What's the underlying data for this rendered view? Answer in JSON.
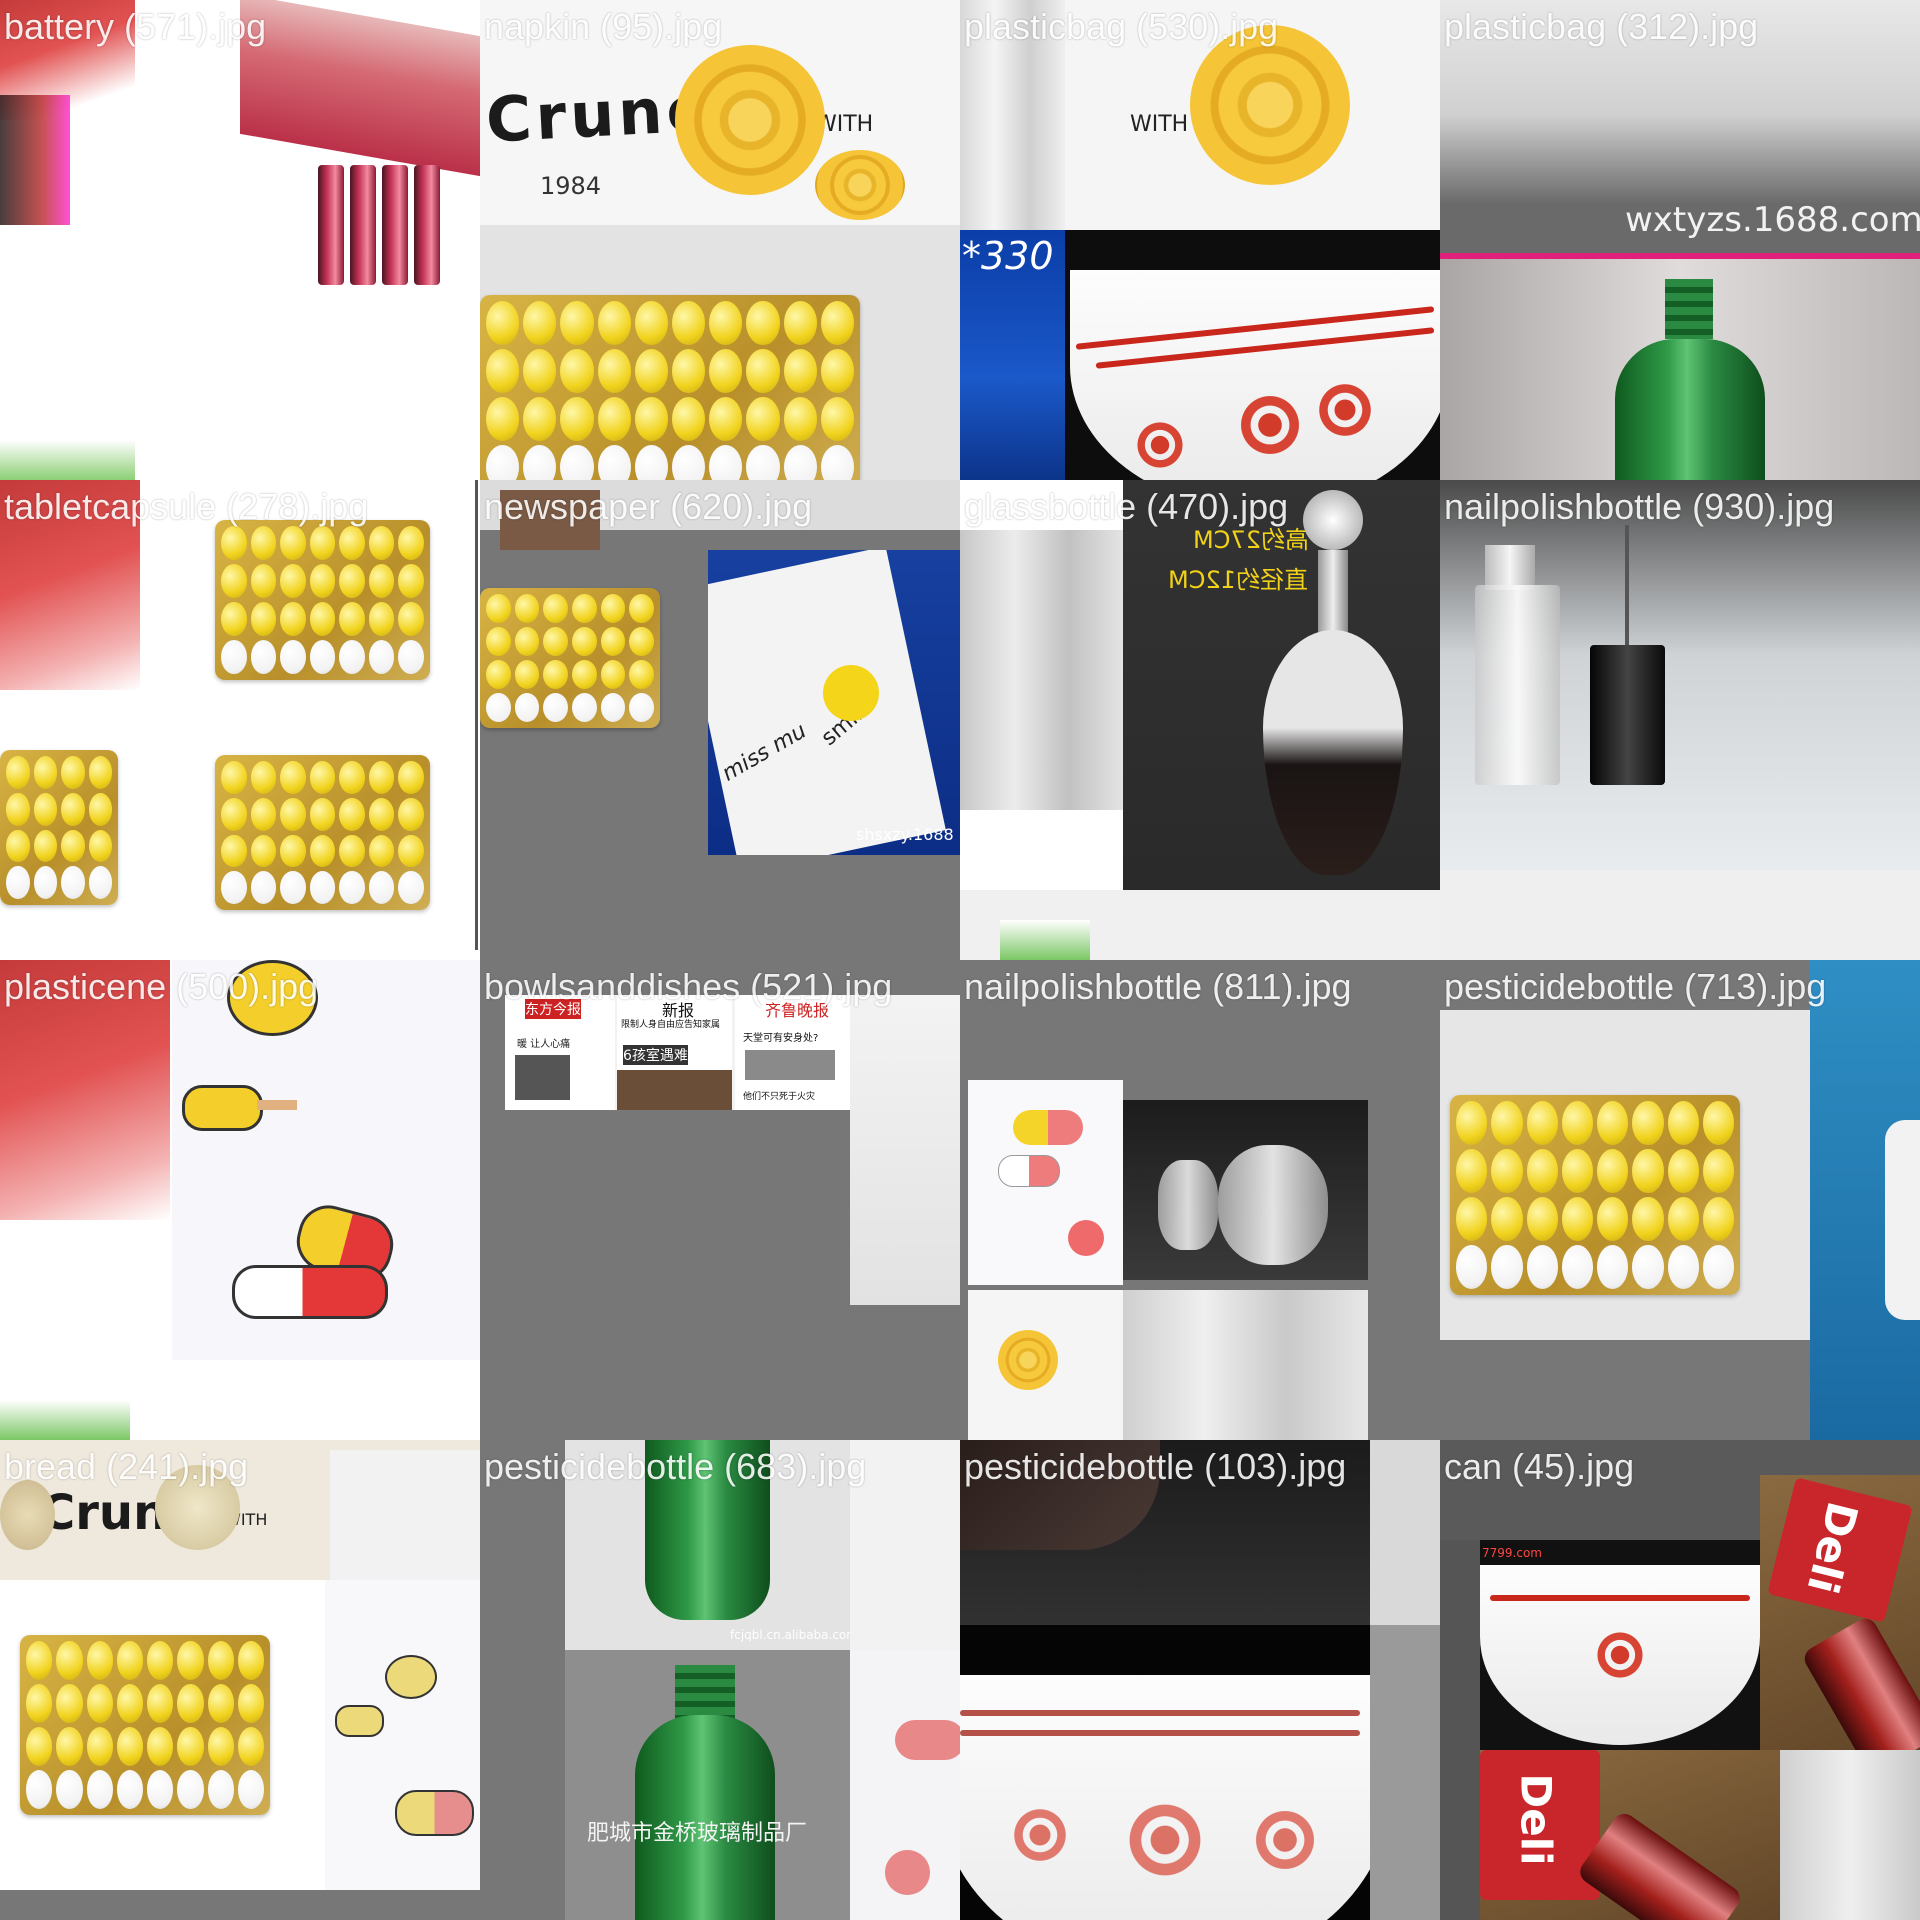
{
  "tiles": [
    {
      "caption": "battery (571).jpg"
    },
    {
      "caption": "napkin (95).jpg"
    },
    {
      "caption": "plasticbag (530).jpg"
    },
    {
      "caption": "plasticbag (312).jpg"
    },
    {
      "caption": "tabletcapsule (278).jpg"
    },
    {
      "caption": "newspaper (620).jpg"
    },
    {
      "caption": "glassbottle (470).jpg"
    },
    {
      "caption": "nailpolishbottle (930).jpg"
    },
    {
      "caption": "plasticene (500).jpg"
    },
    {
      "caption": "bowlsanddishes (521).jpg"
    },
    {
      "caption": "nailpolishbottle (811).jpg"
    },
    {
      "caption": "pesticidebottle (713).jpg"
    },
    {
      "caption": "bread (241).jpg"
    },
    {
      "caption": "pesticidebottle (683).jpg"
    },
    {
      "caption": "pesticidebottle (103).jpg"
    },
    {
      "caption": "can (45).jpg"
    }
  ],
  "photo_text": {
    "napkin_brand": "Crunc",
    "napkin_year": "1984",
    "napkin_with": "WITH",
    "watermark_1688": "wxtyzs.1688.com",
    "bag_size": "*330",
    "glass_cn_1": "高约27CM",
    "glass_cn_2": "直径约12CM",
    "shhxzy": "shsxzy.1688",
    "napkin_smile": "smile",
    "napkin_miss": "miss mu",
    "np_header_1": "东方今报",
    "np_header_2": "新报",
    "np_header_3": "齐鲁晚报",
    "np_head_a": "暖 让人心痛",
    "np_head_b": "6孩室遇难",
    "np_head_c": "天堂可有安身处?",
    "np_head_d": "他们不只死于火灾",
    "np_head_e": "限制人身自由应告知家属",
    "bottle_factory": "肥城市金桥玻璃制品厂",
    "bottle_site": "fcjqbl.cn.alibaba.com",
    "seven_com": "7799.com",
    "can_brand": "Deli"
  }
}
